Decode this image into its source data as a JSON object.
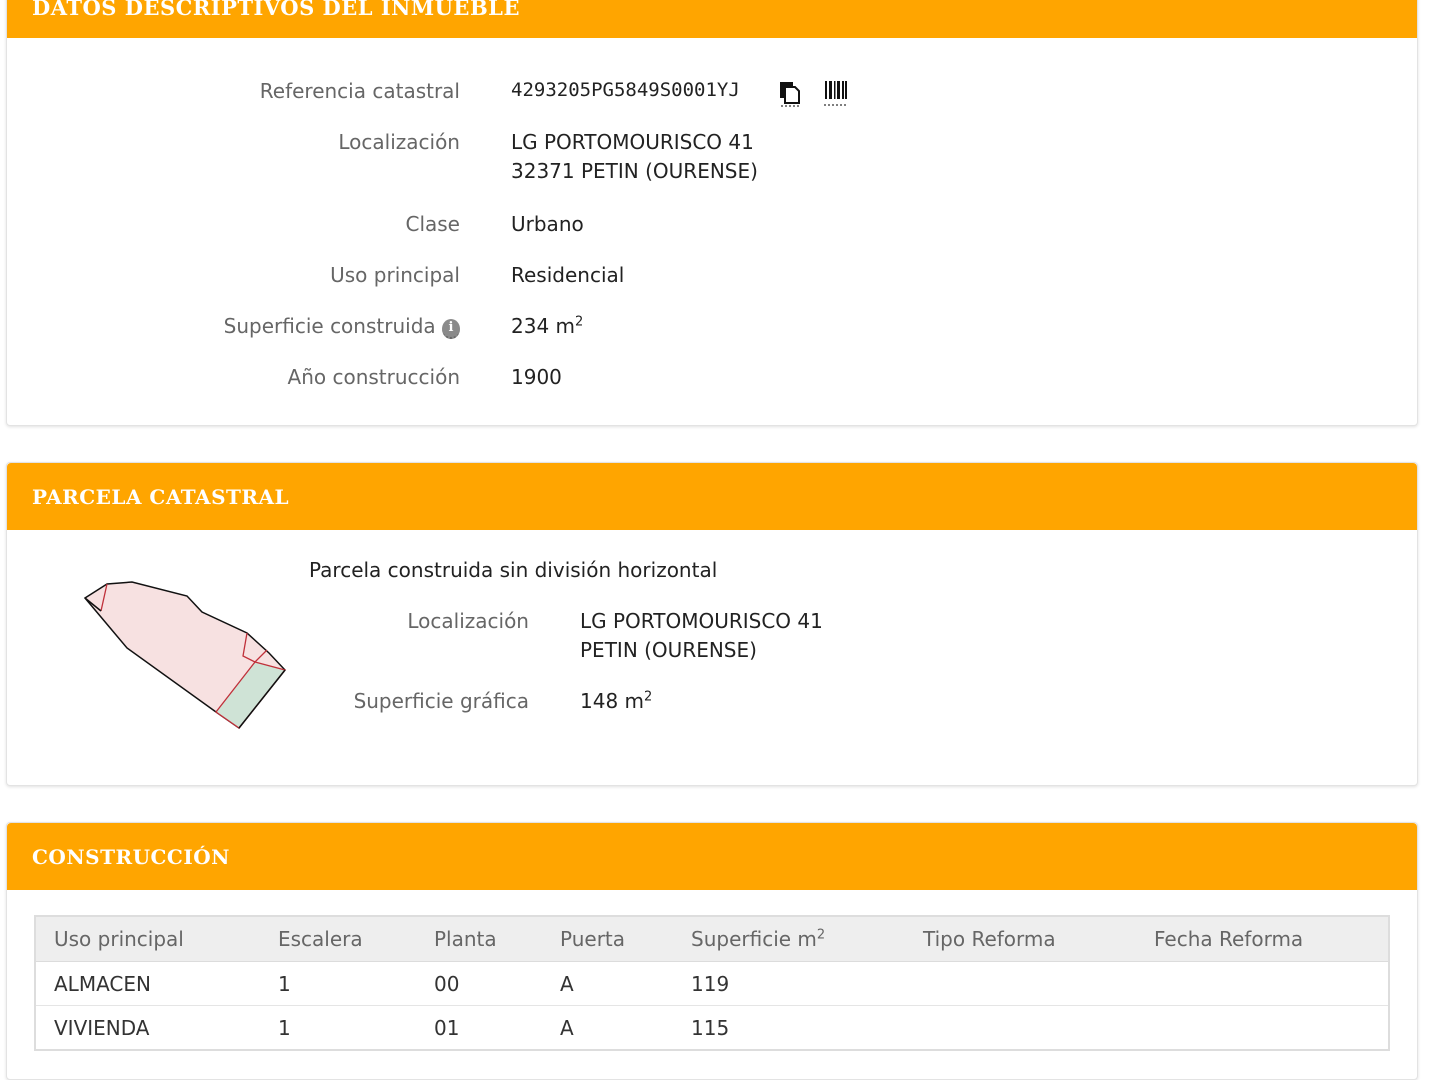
{
  "colors": {
    "header": "#ffa500",
    "header_text": "#ffffff"
  },
  "inmueble": {
    "title": "DATOS DESCRIPTIVOS DEL INMUEBLE",
    "ref_label": "Referencia catastral",
    "ref_value": "4293205PG5849S0001YJ",
    "loc_label": "Localización",
    "loc_line1": "LG PORTOMOURISCO 41",
    "loc_line2": "32371 PETIN (OURENSE)",
    "clase_label": "Clase",
    "clase_value": "Urbano",
    "uso_label": "Uso principal",
    "uso_value": "Residencial",
    "sup_label": "Superficie construida",
    "sup_value": "234 m",
    "sup_unit_sup": "2",
    "anio_label": "Año construcción",
    "anio_value": "1900",
    "icons": [
      "copy-icon",
      "barcode-icon",
      "info-icon"
    ]
  },
  "parcela": {
    "title": "PARCELA CATASTRAL",
    "subtitle": "Parcela construida sin división horizontal",
    "loc_label": "Localización",
    "loc_line1": "LG PORTOMOURISCO 41",
    "loc_line2": "PETIN (OURENSE)",
    "sup_label": "Superficie gráfica",
    "sup_value": "148 m",
    "sup_unit_sup": "2"
  },
  "construccion": {
    "title": "CONSTRUCCIÓN",
    "headers": [
      "Uso principal",
      "Escalera",
      "Planta",
      "Puerta",
      "Superficie m",
      "Tipo Reforma",
      "Fecha Reforma"
    ],
    "sup_header_sup": "2",
    "rows": [
      [
        "ALMACEN",
        "1",
        "00",
        "A",
        "119",
        "",
        ""
      ],
      [
        "VIVIENDA",
        "1",
        "01",
        "A",
        "115",
        "",
        ""
      ]
    ]
  }
}
